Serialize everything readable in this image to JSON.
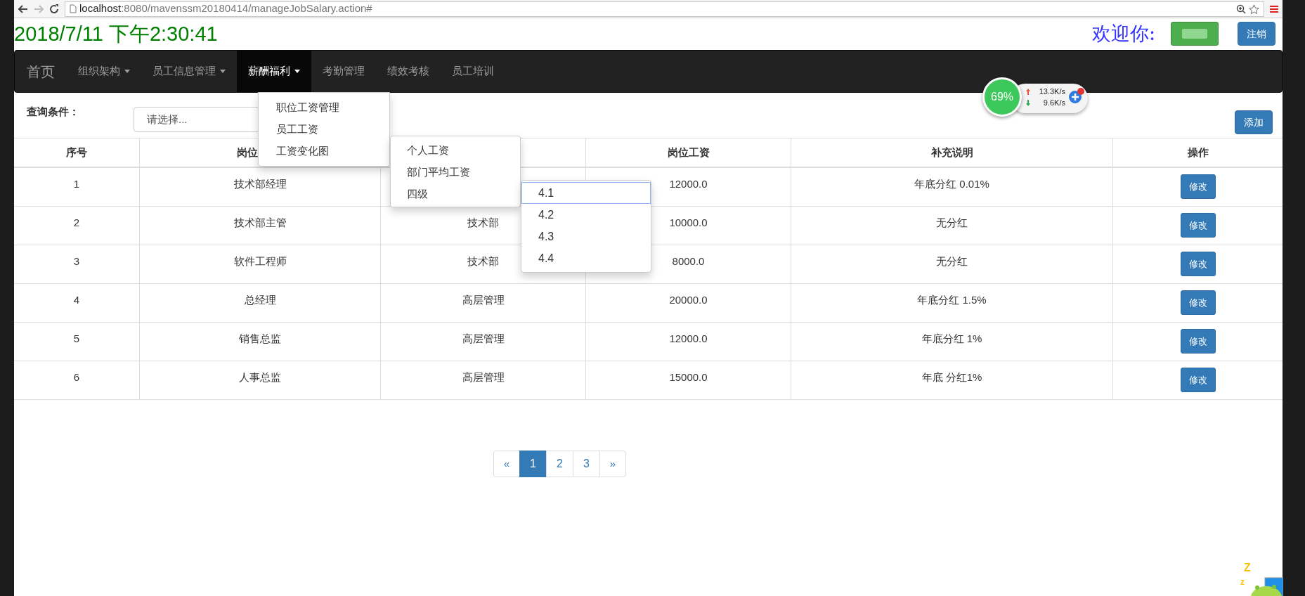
{
  "browser": {
    "url_host": "localhost",
    "url_rest": ":8080/mavenssm20180414/manageJobSalary.action#"
  },
  "header": {
    "datetime": "2018/7/11 下午2:30:41",
    "greeting": "欢迎你:",
    "logout_button": "注销"
  },
  "navbar": {
    "brand": "首页",
    "items": [
      {
        "label": "组织架构",
        "dropdown": true,
        "selected": false
      },
      {
        "label": "员工信息管理",
        "dropdown": true,
        "selected": false
      },
      {
        "label": "薪酬福利",
        "dropdown": true,
        "selected": true
      },
      {
        "label": "考勤管理",
        "dropdown": false,
        "selected": false
      },
      {
        "label": "绩效考核",
        "dropdown": false,
        "selected": false
      },
      {
        "label": "员工培训",
        "dropdown": false,
        "selected": false
      }
    ]
  },
  "nav_dropdown": {
    "items": [
      "职位工资管理",
      "员工工资",
      "工资变化图"
    ]
  },
  "submenu": {
    "items": [
      "个人工资",
      "部门平均工资",
      "四级"
    ]
  },
  "submenu_level4": {
    "items": [
      {
        "label": "4.1",
        "selected": true
      },
      {
        "label": "4.2",
        "selected": false
      },
      {
        "label": "4.3",
        "selected": false
      },
      {
        "label": "4.4",
        "selected": false
      }
    ]
  },
  "network_widget": {
    "percent": "69%",
    "upload": "13.3K/s",
    "download": "9.6K/s"
  },
  "query": {
    "label": "查询条件：",
    "select_placeholder": "请选择...",
    "add_button": "添加"
  },
  "table": {
    "columns": [
      {
        "label": "序号"
      },
      {
        "label": "岗位"
      },
      {},
      {
        "label": "岗位工资"
      },
      {
        "label": "补充说明"
      },
      {
        "label": "操作"
      }
    ],
    "rows": [
      {
        "no": "1",
        "position": "技术部经理",
        "salary": "12000.0",
        "note": "年底分红 0.01%",
        "action": "修改"
      },
      {
        "no": "2",
        "position": "技术部主管",
        "department": "技术部",
        "salary": "10000.0",
        "note": "无分红",
        "action": "修改"
      },
      {
        "no": "3",
        "position": "软件工程师",
        "department": "技术部",
        "salary": "8000.0",
        "note": "无分红",
        "action": "修改"
      },
      {
        "no": "4",
        "position": "总经理",
        "department": "高层管理",
        "salary": "20000.0",
        "note": "年底分红 1.5%",
        "action": "修改"
      },
      {
        "no": "5",
        "position": "销售总监",
        "department": "高层管理",
        "salary": "12000.0",
        "note": "年底分红 1%",
        "action": "修改"
      },
      {
        "no": "6",
        "position": "人事总监",
        "department": "高层管理",
        "salary": "15000.0",
        "note": "年底 分红1%",
        "action": "修改"
      }
    ]
  },
  "pagination": {
    "prev": "«",
    "pages": [
      {
        "label": "1",
        "selected": true
      },
      {
        "label": "2",
        "selected": false
      },
      {
        "label": "3",
        "selected": false
      }
    ],
    "next": "»"
  },
  "desktop_pet": {
    "marks": [
      "Z",
      "z"
    ]
  }
}
